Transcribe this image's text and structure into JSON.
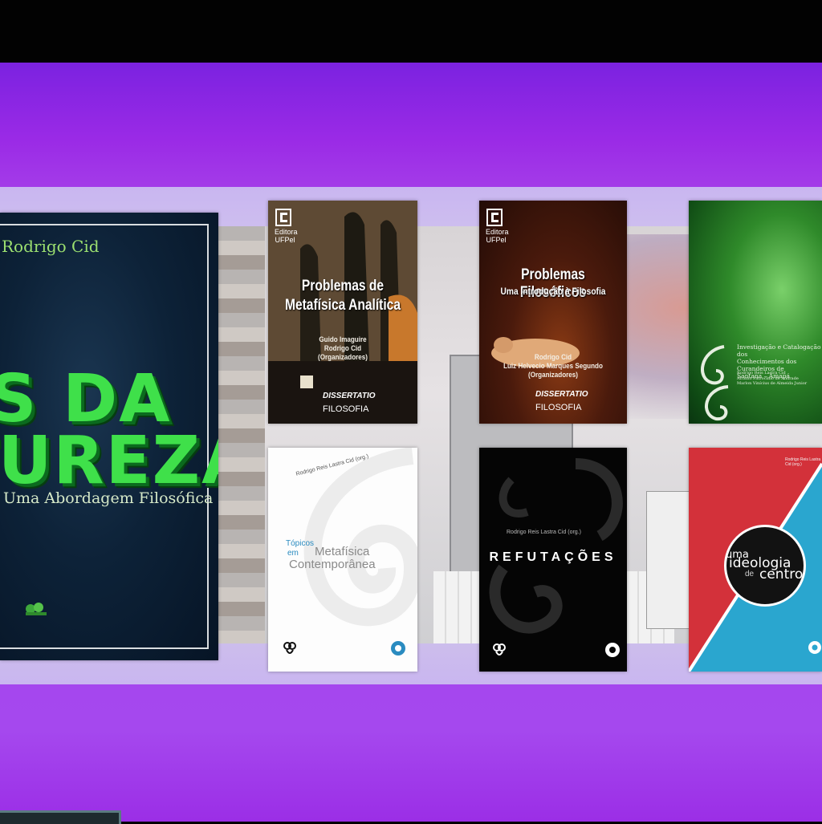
{
  "scene": {
    "accent_wall": "#a33ae8",
    "panel_color": "#d9d2ec"
  },
  "books": [
    {
      "author": "Rodrigo Cid",
      "title_line1": "IS DA",
      "title_line2": "TUREZA",
      "subtitle": "Uma Abordagem Filosófica",
      "colors": {
        "title": "#3fe04a",
        "background": "#0d2238"
      }
    },
    {
      "publisher_line1": "Editora",
      "publisher_line2": "UFPel",
      "title_line1": "Problemas de",
      "title_line2": "Metafísica Analítica",
      "editors": [
        "Guido Imaguire",
        "Rodrigo Cid",
        "(Organizadores)"
      ],
      "series_line1": "DISSERTATIO",
      "series_line2": "FILOSOFIA"
    },
    {
      "publisher_line1": "Editora",
      "publisher_line2": "UFPel",
      "title": "Problemas Filosóficos",
      "subtitle": "Uma Introdução à Filosofia",
      "editors": [
        "Rodrigo Cid",
        "Luiz Helvecio Marques Segundo",
        "(Organizadores)"
      ],
      "series_line1": "DISSERTATIO",
      "series_line2": "FILOSOFIA"
    },
    {
      "description": "Investigação e Catalogação dos\nConhecimentos dos Curandeiros de\nSantana – Amapá",
      "names": "Rodrigo Reis Lastra Cid\nAfrânio Patrocínio de Andrade\nMarlon Vinícius de Almeida Junior",
      "colors": {
        "background": "#2f8a2a"
      }
    },
    {
      "editor": "Rodrigo Reis Lastra Cid (org.)",
      "title_line1": "Tópicos",
      "title_line2": "em",
      "title_line3": "Metafísica",
      "title_line4": "Contemporânea",
      "colors": {
        "accent": "#2a8bc0"
      }
    },
    {
      "editor": "Rodrigo Reis Lastra Cid (org.)",
      "title": "REFUTAÇÕES"
    },
    {
      "editor": "Rodrigo Reis Lastra Cid (org.)",
      "title_word1": "uma",
      "title_word2": "ideologia",
      "title_word3": "de",
      "title_word4": "centro",
      "colors": {
        "red": "#d3313a",
        "blue": "#2aa6cf"
      }
    }
  ]
}
